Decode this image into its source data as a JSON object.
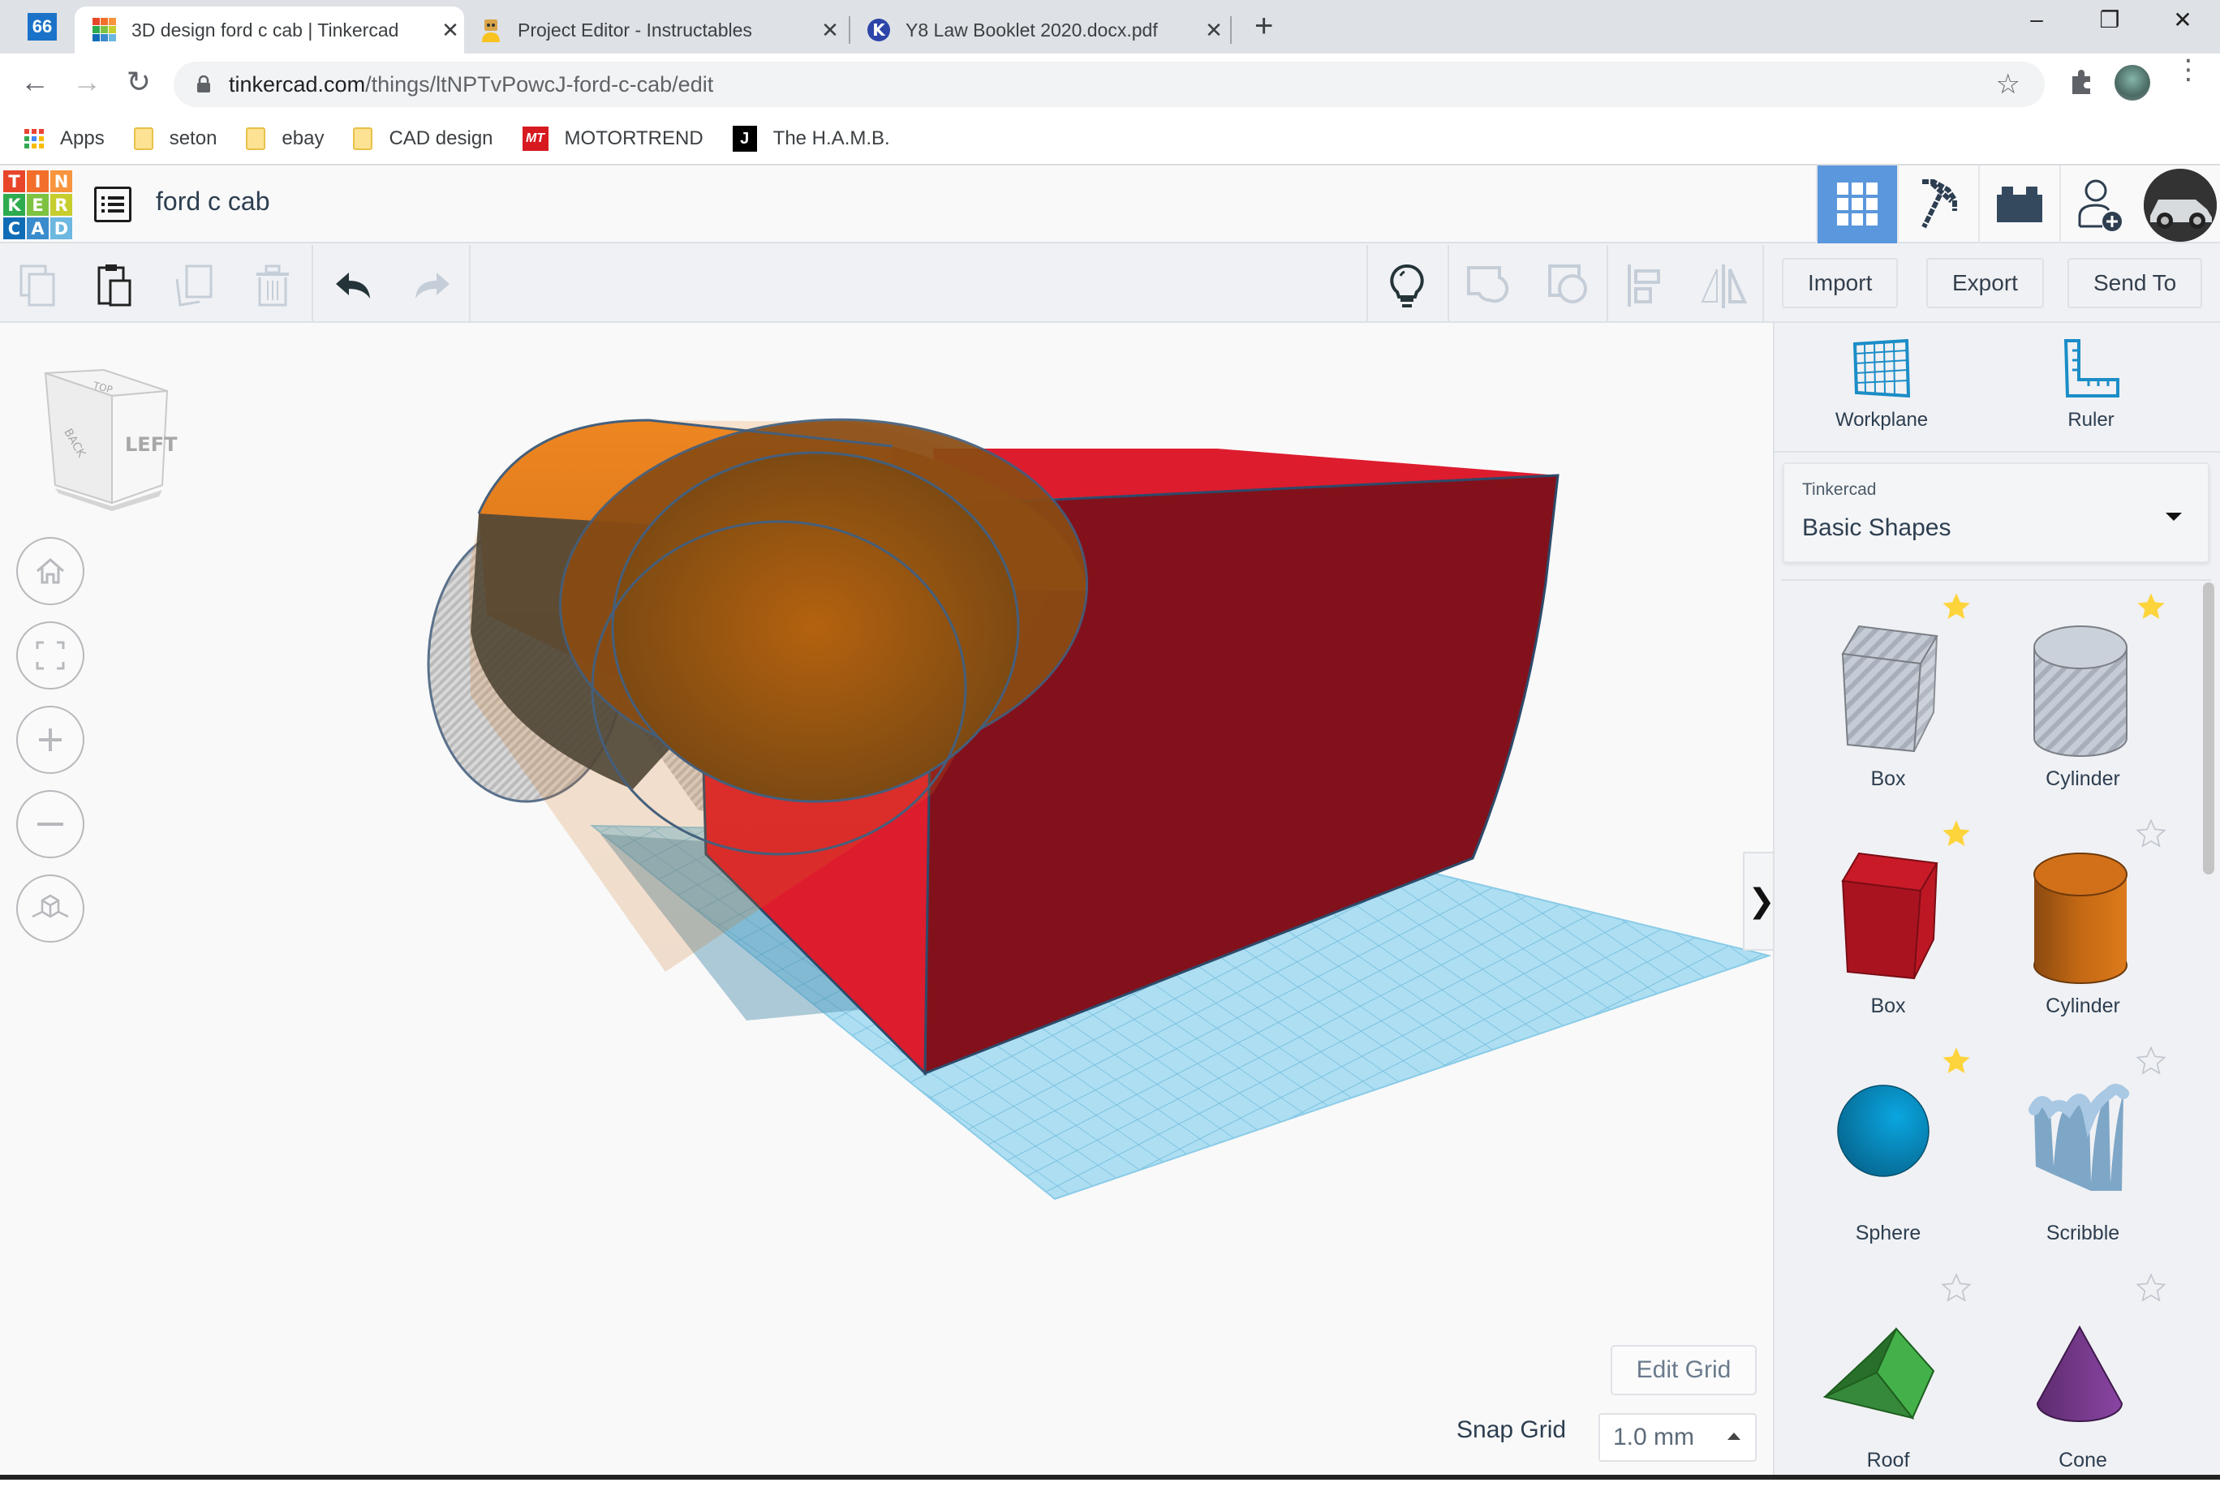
{
  "browser": {
    "tabs": [
      {
        "title": "3D design ford c cab | Tinkercad",
        "active": true,
        "favicon": "tinkercad-icon"
      },
      {
        "title": "Project Editor - Instructables",
        "active": false,
        "favicon": "instructables-robot-icon"
      },
      {
        "title": "Y8 Law Booklet 2020.docx.pdf",
        "active": false,
        "favicon": "k-circle-icon"
      }
    ],
    "pinned_tab_label": "66",
    "new_tab_label": "+",
    "close_glyph": "✕",
    "window_controls": {
      "minimize": "–",
      "restore": "❐",
      "close": "✕"
    },
    "url_host": "tinkercad.com",
    "url_path": "/things/ltNPTvPowcJ-ford-c-cab/edit",
    "bookmarks": [
      {
        "label": "Apps",
        "icon": "apps-grid-icon"
      },
      {
        "label": "seton",
        "icon": "folder-icon"
      },
      {
        "label": "ebay",
        "icon": "folder-icon"
      },
      {
        "label": "CAD design",
        "icon": "folder-icon"
      },
      {
        "label": "MOTORTREND",
        "icon": "motortrend-icon"
      },
      {
        "label": "The H.A.M.B.",
        "icon": "hamb-icon"
      }
    ]
  },
  "app": {
    "logo_letters": [
      "T",
      "I",
      "N",
      "K",
      "E",
      "R",
      "C",
      "A",
      "D"
    ],
    "logo_colors": [
      "#e8462a",
      "#f26f2b",
      "#f7943d",
      "#2eab4e",
      "#7ec242",
      "#c7cd2d",
      "#0f6cb6",
      "#3b8ccc",
      "#6cb8e0"
    ],
    "design_title": "ford c cab",
    "header_buttons": [
      "3d-design-view",
      "codeblocks",
      "bricks",
      "invite-user"
    ],
    "accent_color": "#5b97dc"
  },
  "toolbar": {
    "left_tools": [
      "copy",
      "paste",
      "duplicate",
      "delete",
      "undo",
      "redo"
    ],
    "right_tools": [
      "notes-lightbulb",
      "group",
      "ungroup",
      "align",
      "mirror"
    ],
    "import_label": "Import",
    "export_label": "Export",
    "send_to_label": "Send To"
  },
  "viewport": {
    "view_cube": {
      "front_label": "LEFT",
      "side_label": "BACK",
      "top_label": "TOP"
    },
    "nav_buttons": [
      "home-view",
      "fit-view",
      "zoom-in",
      "zoom-out",
      "ortho-view"
    ],
    "edit_grid_label": "Edit Grid",
    "snap_grid_label": "Snap Grid",
    "snap_grid_value": "1.0 mm",
    "collapse_glyph": "❯",
    "scene_colors": {
      "workplane": "#8fd3f0",
      "box": "#7f1019",
      "box_light": "#dd1c2e",
      "cylinder": "#e58020",
      "hole": "#c9c9c9"
    }
  },
  "panel": {
    "tools": [
      {
        "label": "Workplane",
        "icon": "workplane-icon"
      },
      {
        "label": "Ruler",
        "icon": "ruler-icon"
      }
    ],
    "library_category": "Tinkercad",
    "library_value": "Basic Shapes",
    "shapes": [
      {
        "label": "Box",
        "kind": "box-hole",
        "favorited": true
      },
      {
        "label": "Cylinder",
        "kind": "cylinder-hole",
        "favorited": true
      },
      {
        "label": "Box",
        "kind": "box",
        "favorited": true
      },
      {
        "label": "Cylinder",
        "kind": "cylinder",
        "favorited": false
      },
      {
        "label": "Sphere",
        "kind": "sphere",
        "favorited": true
      },
      {
        "label": "Scribble",
        "kind": "scribble",
        "favorited": false
      },
      {
        "label": "Roof",
        "kind": "roof",
        "favorited": false
      },
      {
        "label": "Cone",
        "kind": "cone",
        "favorited": false
      }
    ]
  }
}
